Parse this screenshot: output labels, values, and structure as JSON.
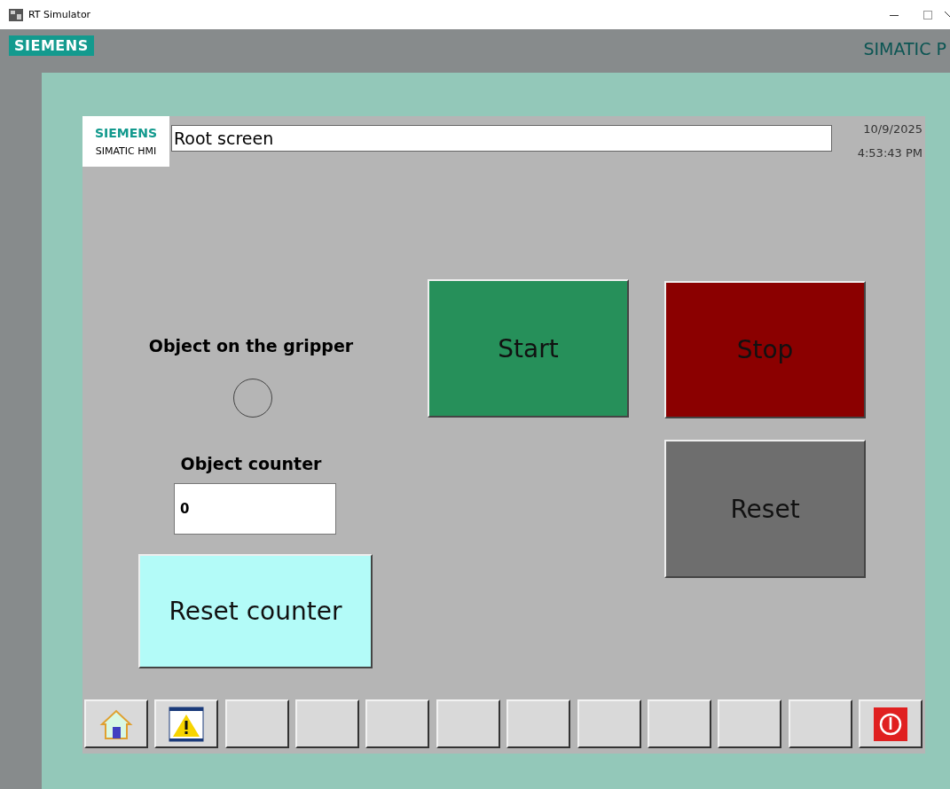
{
  "window": {
    "title": "RT Simulator"
  },
  "panel": {
    "brand": "SIEMENS",
    "model": "SIMATIC P"
  },
  "hmi": {
    "logo": "SIEMENS",
    "product": "SIMATIC HMI",
    "screen_title": "Root screen",
    "date": "10/9/2025",
    "time": "4:53:43 PM"
  },
  "indicator": {
    "label": "Object on the gripper",
    "on": false
  },
  "counter": {
    "label": "Object counter",
    "value": "0"
  },
  "buttons": [
    {
      "label": "Start",
      "color": "#26905a"
    },
    {
      "label": "Stop",
      "color": "#8b0000"
    },
    {
      "label": "Reset",
      "color": "#6e6e6e"
    },
    {
      "label": "Reset counter",
      "color": "#b3fbf8"
    }
  ],
  "function_keys": [
    {
      "kind": "home"
    },
    {
      "kind": "alarm"
    },
    {
      "kind": "blank"
    },
    {
      "kind": "blank"
    },
    {
      "kind": "blank"
    },
    {
      "kind": "blank"
    },
    {
      "kind": "blank"
    },
    {
      "kind": "blank"
    },
    {
      "kind": "blank"
    },
    {
      "kind": "blank"
    },
    {
      "kind": "blank"
    },
    {
      "kind": "power"
    }
  ]
}
